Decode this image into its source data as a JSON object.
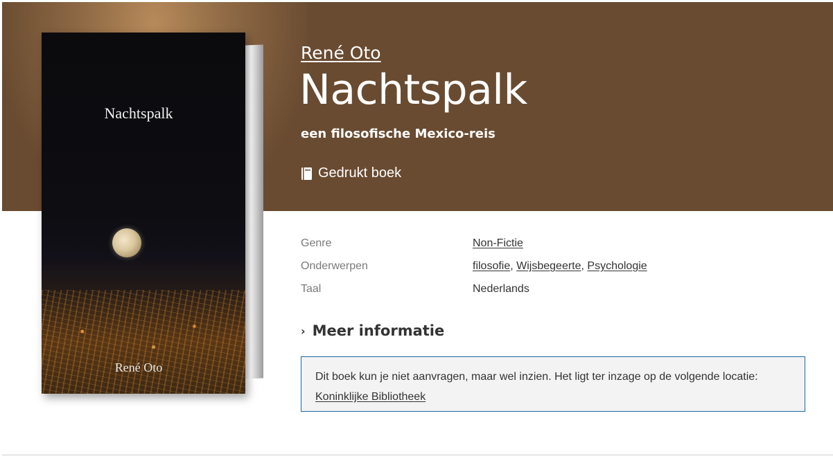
{
  "book": {
    "cover_title": "Nachtspalk",
    "cover_author": "René Oto",
    "author": "René Oto",
    "title": "Nachtspalk",
    "subtitle": "een filosofische Mexico-reis",
    "format": "Gedrukt boek",
    "format_icon": "book-icon"
  },
  "details": {
    "genre_label": "Genre",
    "genre_value": "Non-Fictie",
    "subjects_label": "Onderwerpen",
    "subjects": [
      "filosofie",
      "Wijsbegeerte",
      "Psychologie"
    ],
    "language_label": "Taal",
    "language_value": "Nederlands"
  },
  "more_info": {
    "label": "Meer informatie",
    "icon": "chevron-right-icon"
  },
  "notice": {
    "text": "Dit boek kun je niet aanvragen, maar wel inzien. Het ligt ter inzage op de volgende locatie:",
    "location": "Koninklijke Bibliotheek",
    "border_color": "#1a6aa0"
  },
  "colors": {
    "hero_background": "#694b31",
    "text": "#333333"
  }
}
